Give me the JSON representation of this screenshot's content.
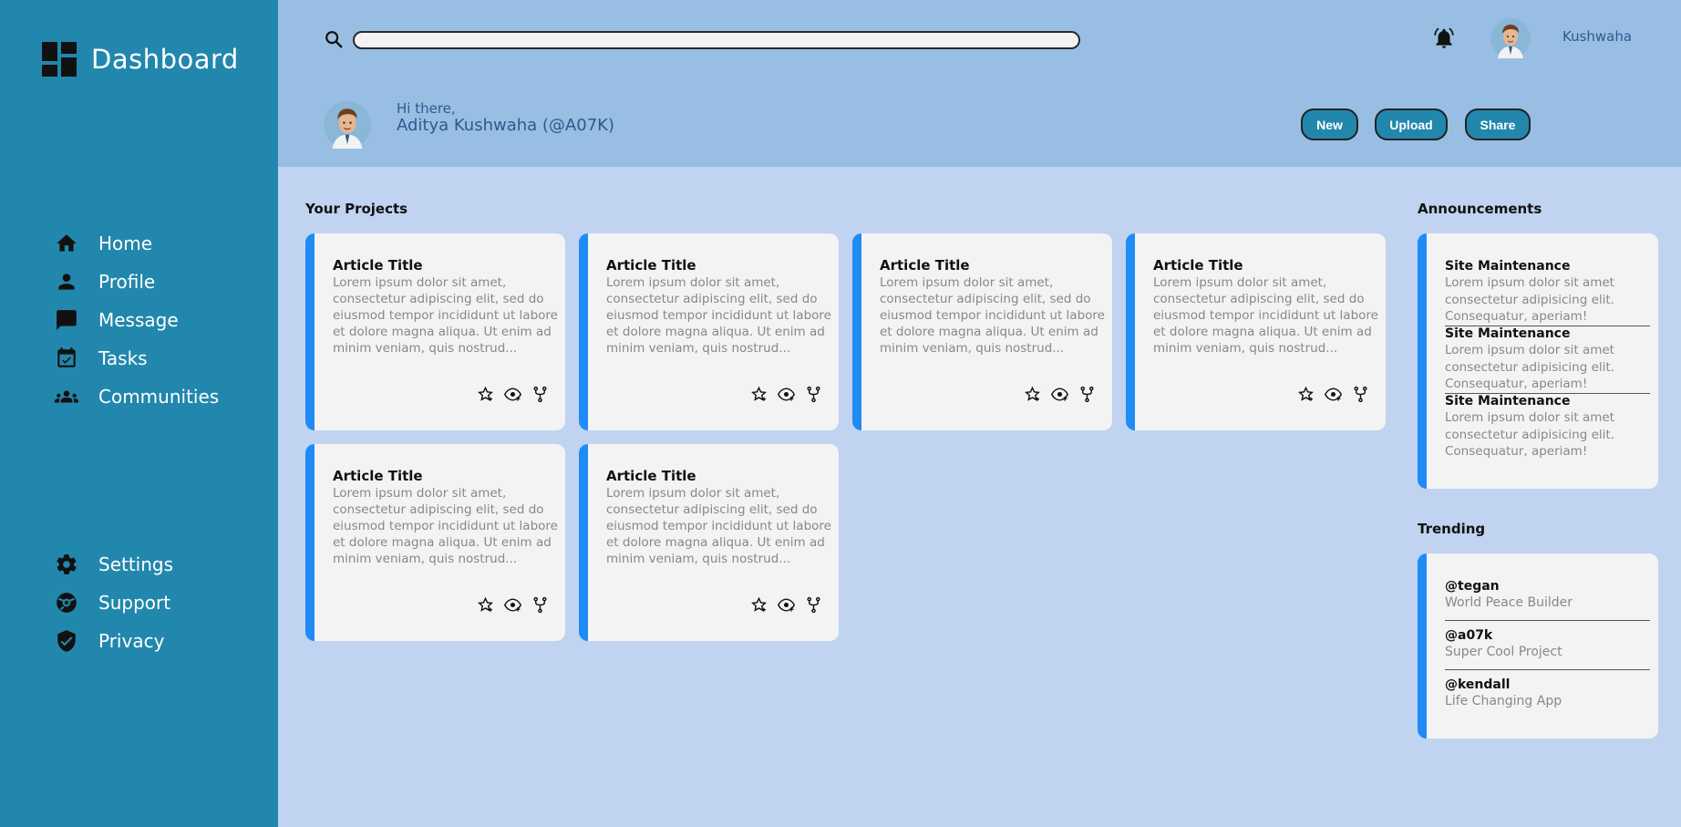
{
  "sidebar": {
    "brand": "Dashboard",
    "items_top": [
      {
        "label": "Home",
        "icon": "home-icon"
      },
      {
        "label": "Profile",
        "icon": "person-icon"
      },
      {
        "label": "Message",
        "icon": "chat-icon"
      },
      {
        "label": "Tasks",
        "icon": "calendar-check-icon"
      },
      {
        "label": "Communities",
        "icon": "group-icon"
      }
    ],
    "items_bottom": [
      {
        "label": "Settings",
        "icon": "gear-icon"
      },
      {
        "label": "Support",
        "icon": "support-icon"
      },
      {
        "label": "Privacy",
        "icon": "shield-icon"
      }
    ]
  },
  "header": {
    "search_placeholder": "",
    "username": "Kushwaha",
    "greeting_small": "Hi there,",
    "greeting_name": "Aditya Kushwaha (@A07K)",
    "buttons": {
      "new": "New",
      "upload": "Upload",
      "share": "Share"
    }
  },
  "projects": {
    "title": "Your Projects",
    "cards": [
      {
        "title": "Article Title",
        "body": "Lorem ipsum dolor sit amet, consectetur adipiscing elit, sed do eiusmod tempor incididunt ut labore et dolore magna aliqua. Ut enim ad minim veniam, quis nostrud..."
      },
      {
        "title": "Article Title",
        "body": "Lorem ipsum dolor sit amet, consectetur adipiscing elit, sed do eiusmod tempor incididunt ut labore et dolore magna aliqua. Ut enim ad minim veniam, quis nostrud..."
      },
      {
        "title": "Article Title",
        "body": "Lorem ipsum dolor sit amet, consectetur adipiscing elit, sed do eiusmod tempor incididunt ut labore et dolore magna aliqua. Ut enim ad minim veniam, quis nostrud..."
      },
      {
        "title": "Article Title",
        "body": "Lorem ipsum dolor sit amet, consectetur adipiscing elit, sed do eiusmod tempor incididunt ut labore et dolore magna aliqua. Ut enim ad minim veniam, quis nostrud..."
      },
      {
        "title": "Article Title",
        "body": "Lorem ipsum dolor sit amet, consectetur adipiscing elit, sed do eiusmod tempor incididunt ut labore et dolore magna aliqua. Ut enim ad minim veniam, quis nostrud..."
      },
      {
        "title": "Article Title",
        "body": "Lorem ipsum dolor sit amet, consectetur adipiscing elit, sed do eiusmod tempor incididunt ut labore et dolore magna aliqua. Ut enim ad minim veniam, quis nostrud..."
      }
    ]
  },
  "announcements": {
    "title": "Announcements",
    "items": [
      {
        "title": "Site Maintenance",
        "body": "Lorem ipsum dolor sit amet consectetur adipisicing elit. Consequatur, aperiam!"
      },
      {
        "title": "Site Maintenance",
        "body": "Lorem ipsum dolor sit amet consectetur adipisicing elit. Consequatur, aperiam!"
      },
      {
        "title": "Site Maintenance",
        "body": "Lorem ipsum dolor sit amet consectetur adipisicing elit. Consequatur, aperiam!"
      }
    ]
  },
  "trending": {
    "title": "Trending",
    "items": [
      {
        "handle": "@tegan",
        "desc": "World Peace Builder"
      },
      {
        "handle": "@a07k",
        "desc": "Super Cool Project"
      },
      {
        "handle": "@kendall",
        "desc": "Life Changing App"
      }
    ]
  },
  "colors": {
    "sidebar": "#2287ac",
    "header": "#98bfe3",
    "background": "#c0d3f0",
    "card_accent": "#1f8bf5",
    "card": "#f3f3f3"
  }
}
